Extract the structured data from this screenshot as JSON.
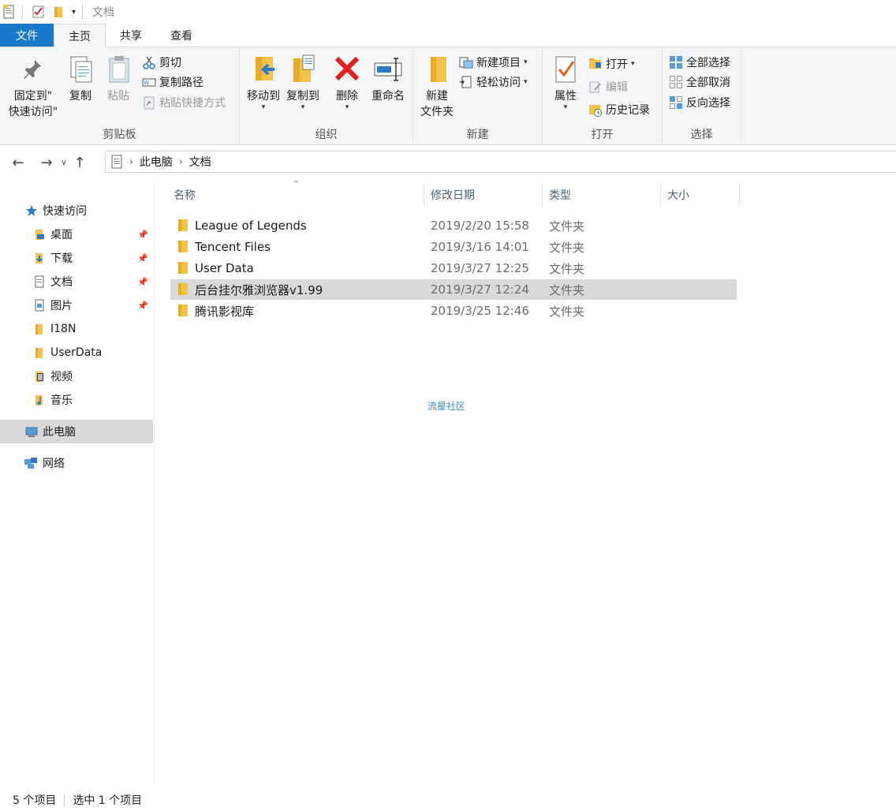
{
  "window": {
    "title": "文档"
  },
  "tabs": [
    {
      "label": "文件"
    },
    {
      "label": "主页"
    },
    {
      "label": "共享"
    },
    {
      "label": "查看"
    }
  ],
  "ribbon": {
    "clipboard": {
      "label": "剪贴板",
      "pin_label": "固定到\"\n快速访问\"",
      "pin_line1": "固定到\"",
      "pin_line2": "快速访问\"",
      "copy": "复制",
      "paste": "粘贴",
      "cut": "剪切",
      "copy_path": "复制路径",
      "paste_shortcut": "粘贴快捷方式"
    },
    "organize": {
      "label": "组织",
      "move_to": "移动到",
      "copy_to": "复制到",
      "delete": "删除",
      "rename": "重命名"
    },
    "new": {
      "label": "新建",
      "new_folder_line1": "新建",
      "new_folder_line2": "文件夹",
      "new_item": "新建项目",
      "easy_access": "轻松访问"
    },
    "open": {
      "label": "打开",
      "properties": "属性",
      "open": "打开",
      "edit": "编辑",
      "history": "历史记录"
    },
    "select": {
      "label": "选择",
      "select_all": "全部选择",
      "select_none": "全部取消",
      "invert": "反向选择"
    }
  },
  "address": {
    "crumbs": [
      "此电脑",
      "文档"
    ]
  },
  "nav": {
    "quick_access": "快速访问",
    "items": [
      {
        "label": "桌面",
        "pinned": true
      },
      {
        "label": "下载",
        "pinned": true
      },
      {
        "label": "文档",
        "pinned": true
      },
      {
        "label": "图片",
        "pinned": true
      },
      {
        "label": "I18N",
        "pinned": false
      },
      {
        "label": "UserData",
        "pinned": false
      },
      {
        "label": "视频",
        "pinned": false
      },
      {
        "label": "音乐",
        "pinned": false
      }
    ],
    "this_pc": "此电脑",
    "network": "网络"
  },
  "columns": {
    "name": "名称",
    "date": "修改日期",
    "type": "类型",
    "size": "大小"
  },
  "files": [
    {
      "name": "League of Legends",
      "date": "2019/2/20 15:58",
      "type": "文件夹"
    },
    {
      "name": "Tencent Files",
      "date": "2019/3/16 14:01",
      "type": "文件夹"
    },
    {
      "name": "User Data",
      "date": "2019/3/27 12:25",
      "type": "文件夹"
    },
    {
      "name": "后台挂尔雅浏览器v1.99",
      "date": "2019/3/27 12:24",
      "type": "文件夹",
      "selected": true
    },
    {
      "name": "腾讯影视库",
      "date": "2019/3/25 12:46",
      "type": "文件夹"
    }
  ],
  "watermark": "流星社区",
  "status": {
    "count": "5 个项目",
    "selected": "选中 1 个项目"
  },
  "colors": {
    "file_tab": "#1979ca",
    "selection": "#d9d9d9",
    "folder": "#f3c24a"
  }
}
